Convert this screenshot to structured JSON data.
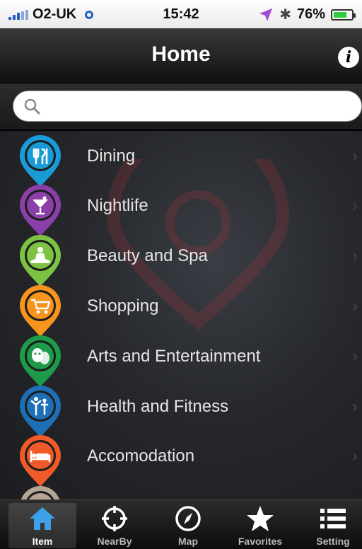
{
  "status": {
    "carrier": "O2-UK",
    "time": "15:42",
    "battery": "76%",
    "battery_level": 0.76
  },
  "nav": {
    "title": "Home",
    "info_icon": "info-icon"
  },
  "search": {
    "placeholder": "",
    "value": ""
  },
  "categories": [
    {
      "label": "Dining",
      "color": "#1a9bd7",
      "icon": "utensils-icon"
    },
    {
      "label": "Nightlife",
      "color": "#8b3fa8",
      "icon": "cocktail-icon"
    },
    {
      "label": "Beauty and Spa",
      "color": "#7dc242",
      "icon": "meditation-icon"
    },
    {
      "label": "Shopping",
      "color": "#f7941d",
      "icon": "cart-icon"
    },
    {
      "label": "Arts and Entertainment",
      "color": "#1e9b48",
      "icon": "theater-masks-icon"
    },
    {
      "label": "Health and Fitness",
      "color": "#1f6fb6",
      "icon": "fitness-icon"
    },
    {
      "label": "Accomodation",
      "color": "#ef5a28",
      "icon": "bed-icon"
    },
    {
      "label": "",
      "color": "#b4a597",
      "icon": "partial-pin-icon"
    }
  ],
  "tabs": [
    {
      "label": "Item",
      "icon": "home-icon",
      "active": true
    },
    {
      "label": "NearBy",
      "icon": "crosshair-icon",
      "active": false
    },
    {
      "label": "Map",
      "icon": "compass-icon",
      "active": false
    },
    {
      "label": "Favorites",
      "icon": "star-icon",
      "active": false
    },
    {
      "label": "Setting",
      "icon": "list-icon",
      "active": false
    }
  ]
}
